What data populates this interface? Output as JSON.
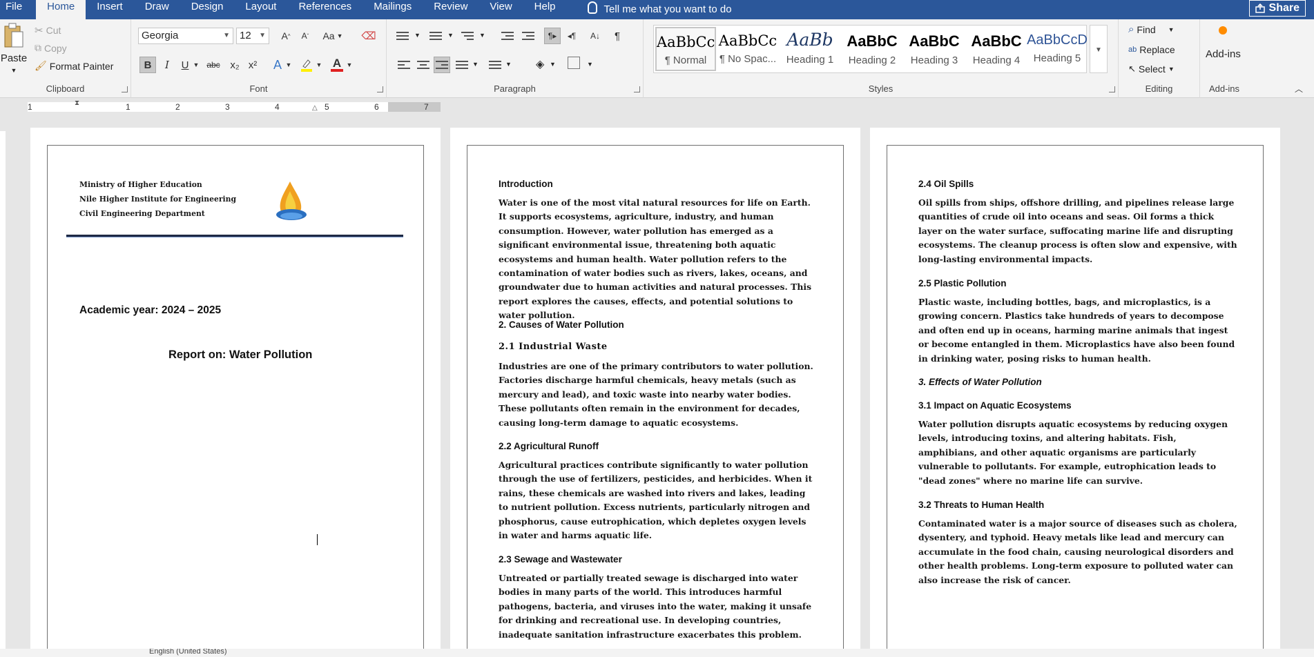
{
  "tabs": [
    "File",
    "Home",
    "Insert",
    "Draw",
    "Design",
    "Layout",
    "References",
    "Mailings",
    "Review",
    "View",
    "Help"
  ],
  "active_tab": "Home",
  "tell_me": "Tell me what you want to do",
  "share": "Share",
  "clipboard": {
    "paste": "Paste",
    "cut": "Cut",
    "copy": "Copy",
    "format_painter": "Format Painter",
    "label": "Clipboard"
  },
  "font": {
    "family": "Georgia",
    "size": "12",
    "label": "Font",
    "bold": "B",
    "italic": "I",
    "underline": "U",
    "strike": "abc",
    "subscript": "x₂",
    "superscript": "x²",
    "grow": "A",
    "shrink": "A",
    "case": "Aa",
    "color_letter": "A"
  },
  "paragraph": {
    "label": "Paragraph"
  },
  "styles": {
    "label": "Styles",
    "items": [
      {
        "preview": "AaBbCc",
        "name": "¶ Normal"
      },
      {
        "preview": "AaBbCc",
        "name": "¶ No Spac..."
      },
      {
        "preview": "AaBb",
        "name": "Heading 1"
      },
      {
        "preview": "AaBbC",
        "name": "Heading 2"
      },
      {
        "preview": "AaBbC",
        "name": "Heading 3"
      },
      {
        "preview": "AaBbC",
        "name": "Heading 4"
      },
      {
        "preview": "AaBbCcD",
        "name": "Heading 5"
      }
    ]
  },
  "editing": {
    "label": "Editing",
    "find": "Find",
    "replace": "Replace",
    "select": "Select"
  },
  "addins": {
    "button": "Add-ins",
    "label": "Add-ins"
  },
  "ruler": {
    "numbers": [
      "1",
      "1",
      "2",
      "3",
      "4",
      "5",
      "6",
      "7"
    ]
  },
  "page1": {
    "header_lines": [
      "Ministry of Higher Education",
      "Nile Higher Institute for Engineering",
      "Civil Engineering Department"
    ],
    "academic_year": "Academic year: 2024 – 2025",
    "report_title": "Report on: Water Pollution"
  },
  "page2": {
    "intro_heading": "Introduction",
    "intro_text": "Water is one of the most vital natural resources for life on Earth. It supports ecosystems, agriculture, industry, and human consumption. However, water pollution has emerged as a significant environmental issue, threatening both aquatic ecosystems and human health. Water pollution refers to the contamination of water bodies such as rivers, lakes, oceans, and groundwater due to human activities and natural processes. This report explores the causes, effects, and potential solutions to water pollution.",
    "causes_heading": "2. Causes of Water Pollution",
    "industrial_heading": "2.1 Industrial Waste",
    "industrial_text": "Industries are one of the primary contributors to water pollution. Factories discharge harmful chemicals, heavy metals (such as mercury and lead), and toxic waste into nearby water bodies. These pollutants often remain in the environment for decades, causing long-term damage to aquatic ecosystems.",
    "agri_heading": "2.2 Agricultural Runoff",
    "agri_text": "Agricultural practices contribute significantly to water pollution through the use of fertilizers, pesticides, and herbicides. When it rains, these chemicals are washed into rivers and lakes, leading to nutrient pollution. Excess nutrients, particularly nitrogen and phosphorus, cause eutrophication, which depletes oxygen levels in water and harms aquatic life.",
    "sewage_heading": "2.3 Sewage and Wastewater",
    "sewage_text": "Untreated or partially treated sewage is discharged into water bodies in many parts of the world. This introduces harmful pathogens, bacteria, and viruses into the water, making it unsafe for drinking and recreational use. In developing countries, inadequate sanitation infrastructure exacerbates this problem."
  },
  "page3": {
    "oil_heading": "2.4 Oil Spills",
    "oil_text": "Oil spills from ships, offshore drilling, and pipelines release large quantities of crude oil into oceans and seas. Oil forms a thick layer on the water surface, suffocating marine life and disrupting ecosystems. The cleanup process is often slow and expensive, with long-lasting environmental impacts.",
    "plastic_heading": "2.5 Plastic Pollution",
    "plastic_text": "Plastic waste, including bottles, bags, and microplastics, is a growing concern. Plastics take hundreds of years to decompose and often end up in oceans, harming marine animals that ingest or become entangled in them. Microplastics have also been found in drinking water, posing risks to human health.",
    "effects_heading": "3. Effects of Water Pollution",
    "aquatic_heading": "3.1 Impact on Aquatic Ecosystems",
    "aquatic_text": "Water pollution disrupts aquatic ecosystems by reducing oxygen levels, introducing toxins, and altering habitats. Fish, amphibians, and other aquatic organisms are particularly vulnerable to pollutants. For example, eutrophication leads to \"dead zones\" where no marine life can survive.",
    "health_heading": "3.2 Threats to Human Health",
    "health_text": "Contaminated water is a major source of diseases such as cholera, dysentery, and typhoid. Heavy metals like lead and mercury can accumulate in the food chain, causing neurological disorders and other health problems. Long-term exposure to polluted water can also increase the risk of cancer."
  },
  "status": {
    "language": "English (United States)"
  },
  "colors": {
    "brand": "#2b579a",
    "ribbon": "#f3f3f3",
    "canvas": "#e6e6e6"
  }
}
